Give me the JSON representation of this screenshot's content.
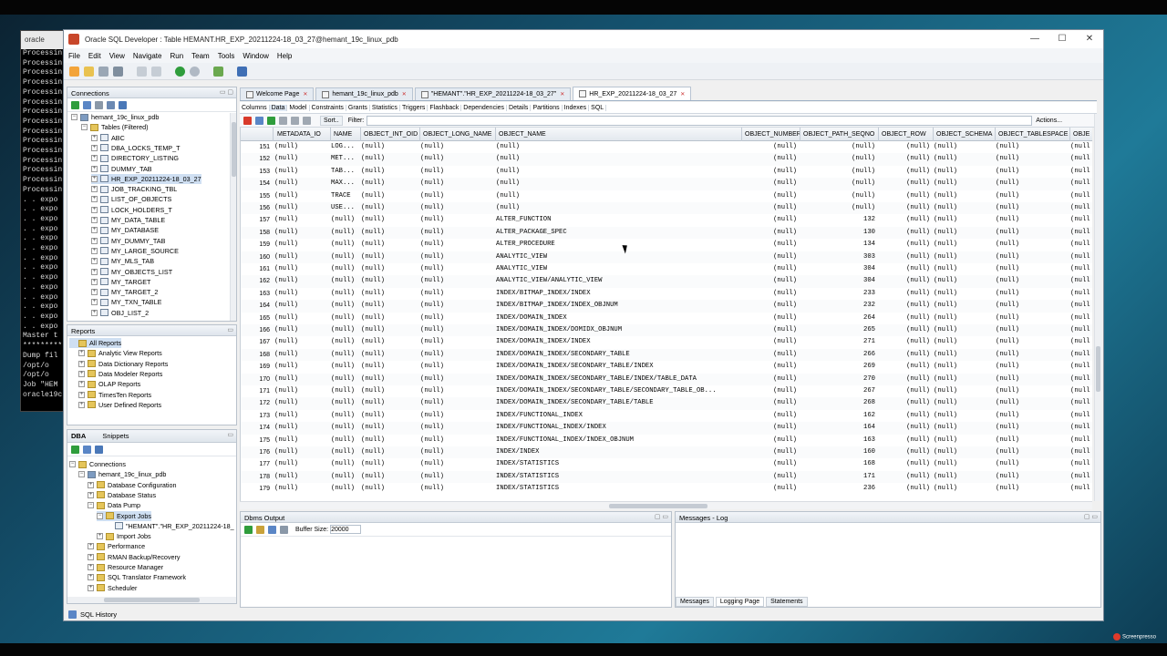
{
  "terminal": {
    "title": "oracle",
    "lines": [
      "Processin",
      "Processin",
      "Processin",
      "Processin",
      "Processin",
      "Processin",
      "Processin",
      "Processin",
      "Processin",
      "Processin",
      "Processin",
      "Processin",
      "Processin",
      "Processin",
      "Processin",
      ". . expo",
      ". . expo",
      ". . expo",
      ". . expo",
      ". . expo",
      ". . expo",
      ". . expo",
      ". . expo",
      ". . expo",
      ". . expo",
      ". . expo",
      ". . expo",
      ". . expo",
      ". . expo",
      "Master t",
      "*********",
      "Dump fil",
      "  /opt/o",
      "  /opt/o",
      "Job \"HEM",
      "oracle19c"
    ]
  },
  "window": {
    "title": "Oracle SQL Developer : Table HEMANT.HR_EXP_20211224-18_03_27@hemant_19c_linux_pdb",
    "minimize": "—",
    "maximize": "☐",
    "close": "✕"
  },
  "menu": [
    "File",
    "Edit",
    "View",
    "Navigate",
    "Run",
    "Team",
    "Tools",
    "Window",
    "Help"
  ],
  "connections": {
    "title": "Connections",
    "nodes": [
      {
        "label": "hemant_19c_linux_pdb",
        "level": 0,
        "icon": "db",
        "exp": "−"
      },
      {
        "label": "Tables (Filtered)",
        "level": 1,
        "icon": "folder",
        "exp": "−"
      },
      {
        "label": "ABC",
        "level": 2,
        "icon": "table",
        "exp": "+"
      },
      {
        "label": "DBA_LOCKS_TEMP_T",
        "level": 2,
        "icon": "table",
        "exp": "+"
      },
      {
        "label": "DIRECTORY_LISTING",
        "level": 2,
        "icon": "table",
        "exp": "+"
      },
      {
        "label": "DUMMY_TAB",
        "level": 2,
        "icon": "table",
        "exp": "+"
      },
      {
        "label": "HR_EXP_20211224-18_03_27",
        "level": 2,
        "icon": "table",
        "exp": "+",
        "selected": true
      },
      {
        "label": "JOB_TRACKING_TBL",
        "level": 2,
        "icon": "table",
        "exp": "+"
      },
      {
        "label": "LIST_OF_OBJECTS",
        "level": 2,
        "icon": "table",
        "exp": "+"
      },
      {
        "label": "LOCK_HOLDERS_T",
        "level": 2,
        "icon": "table",
        "exp": "+"
      },
      {
        "label": "MY_DATA_TABLE",
        "level": 2,
        "icon": "table",
        "exp": "+"
      },
      {
        "label": "MY_DATABASE",
        "level": 2,
        "icon": "table",
        "exp": "+"
      },
      {
        "label": "MY_DUMMY_TAB",
        "level": 2,
        "icon": "table",
        "exp": "+"
      },
      {
        "label": "MY_LARGE_SOURCE",
        "level": 2,
        "icon": "table",
        "exp": "+"
      },
      {
        "label": "MY_MLS_TAB",
        "level": 2,
        "icon": "table",
        "exp": "+"
      },
      {
        "label": "MY_OBJECTS_LIST",
        "level": 2,
        "icon": "table",
        "exp": "+"
      },
      {
        "label": "MY_TARGET",
        "level": 2,
        "icon": "table",
        "exp": "+"
      },
      {
        "label": "MY_TARGET_2",
        "level": 2,
        "icon": "table",
        "exp": "+"
      },
      {
        "label": "MY_TXN_TABLE",
        "level": 2,
        "icon": "table",
        "exp": "+"
      },
      {
        "label": "OBJ_LIST_2",
        "level": 2,
        "icon": "table",
        "exp": "+"
      }
    ]
  },
  "reports": {
    "title": "Reports",
    "nodes": [
      {
        "label": "All Reports",
        "level": 0,
        "icon": "folder",
        "exp": "",
        "selected": true
      },
      {
        "label": "Analytic View Reports",
        "level": 1,
        "icon": "folder",
        "exp": "+"
      },
      {
        "label": "Data Dictionary Reports",
        "level": 1,
        "icon": "folder",
        "exp": "+"
      },
      {
        "label": "Data Modeler Reports",
        "level": 1,
        "icon": "folder",
        "exp": "+"
      },
      {
        "label": "OLAP Reports",
        "level": 1,
        "icon": "folder",
        "exp": "+"
      },
      {
        "label": "TimesTen Reports",
        "level": 1,
        "icon": "folder",
        "exp": "+"
      },
      {
        "label": "User Defined Reports",
        "level": 1,
        "icon": "folder",
        "exp": "+"
      }
    ]
  },
  "dba": {
    "tabs": [
      "DBA",
      "Snippets"
    ],
    "nodes": [
      {
        "label": "Connections",
        "level": 0,
        "icon": "folder",
        "exp": "−"
      },
      {
        "label": "hemant_19c_linux_pdb",
        "level": 1,
        "icon": "db",
        "exp": "−"
      },
      {
        "label": "Database Configuration",
        "level": 2,
        "icon": "folder",
        "exp": "+"
      },
      {
        "label": "Database Status",
        "level": 2,
        "icon": "folder",
        "exp": "+"
      },
      {
        "label": "Data Pump",
        "level": 2,
        "icon": "folder",
        "exp": "−"
      },
      {
        "label": "Export Jobs",
        "level": 3,
        "icon": "folder",
        "exp": "−",
        "selected": true
      },
      {
        "label": "\"HEMANT\".\"HR_EXP_20211224-18_",
        "level": 4,
        "icon": "table",
        "exp": ""
      },
      {
        "label": "Import Jobs",
        "level": 3,
        "icon": "folder",
        "exp": "+"
      },
      {
        "label": "Performance",
        "level": 2,
        "icon": "folder",
        "exp": "+"
      },
      {
        "label": "RMAN Backup/Recovery",
        "level": 2,
        "icon": "folder",
        "exp": "+"
      },
      {
        "label": "Resource Manager",
        "level": 2,
        "icon": "folder",
        "exp": "+"
      },
      {
        "label": "SQL Translator Framework",
        "level": 2,
        "icon": "folder",
        "exp": "+"
      },
      {
        "label": "Scheduler",
        "level": 2,
        "icon": "folder",
        "exp": "+"
      }
    ]
  },
  "doc_tabs": [
    {
      "label": "Welcome Page",
      "active": false
    },
    {
      "label": "hemant_19c_linux_pdb",
      "active": false
    },
    {
      "label": "\"HEMANT\".\"HR_EXP_20211224-18_03_27\"",
      "active": false
    },
    {
      "label": "HR_EXP_20211224-18_03_27",
      "active": true
    }
  ],
  "sub_tabs": [
    "Columns",
    "Data",
    "Model",
    "Constraints",
    "Grants",
    "Statistics",
    "Triggers",
    "Flashback",
    "Dependencies",
    "Details",
    "Partitions",
    "Indexes",
    "SQL"
  ],
  "grid_toolbar": {
    "sort": "Sort..",
    "filter_label": "Filter:",
    "filter_value": "",
    "actions": "Actions..."
  },
  "columns": [
    "",
    "METADATA_IO",
    "NAME",
    "OBJECT_INT_OID",
    "OBJECT_LONG_NAME",
    "OBJECT_NAME",
    "OBJECT_NUMBER",
    "OBJECT_PATH_SEQNO",
    "OBJECT_ROW",
    "OBJECT_SCHEMA",
    "OBJECT_TABLESPACE",
    "OBJE"
  ],
  "rows": [
    [
      "151",
      "(null)",
      "LOG...",
      "(null)",
      "(null)",
      "(null)",
      "(null)",
      "(null)",
      "(null)",
      "(null)",
      "(null)",
      "(null"
    ],
    [
      "152",
      "(null)",
      "MET...",
      "(null)",
      "(null)",
      "(null)",
      "(null)",
      "(null)",
      "(null)",
      "(null)",
      "(null)",
      "(null"
    ],
    [
      "153",
      "(null)",
      "TAB...",
      "(null)",
      "(null)",
      "(null)",
      "(null)",
      "(null)",
      "(null)",
      "(null)",
      "(null)",
      "(null"
    ],
    [
      "154",
      "(null)",
      "MAX...",
      "(null)",
      "(null)",
      "(null)",
      "(null)",
      "(null)",
      "(null)",
      "(null)",
      "(null)",
      "(null"
    ],
    [
      "155",
      "(null)",
      "TRACE",
      "(null)",
      "(null)",
      "(null)",
      "(null)",
      "(null)",
      "(null)",
      "(null)",
      "(null)",
      "(null"
    ],
    [
      "156",
      "(null)",
      "USE...",
      "(null)",
      "(null)",
      "(null)",
      "(null)",
      "(null)",
      "(null)",
      "(null)",
      "(null)",
      "(null"
    ],
    [
      "157",
      "(null)",
      "(null)",
      "(null)",
      "(null)",
      "ALTER_FUNCTION",
      "(null)",
      "132",
      "(null)",
      "(null)",
      "(null)",
      "(null"
    ],
    [
      "158",
      "(null)",
      "(null)",
      "(null)",
      "(null)",
      "ALTER_PACKAGE_SPEC",
      "(null)",
      "130",
      "(null)",
      "(null)",
      "(null)",
      "(null"
    ],
    [
      "159",
      "(null)",
      "(null)",
      "(null)",
      "(null)",
      "ALTER_PROCEDURE",
      "(null)",
      "134",
      "(null)",
      "(null)",
      "(null)",
      "(null"
    ],
    [
      "160",
      "(null)",
      "(null)",
      "(null)",
      "(null)",
      "ANALYTIC_VIEW",
      "(null)",
      "303",
      "(null)",
      "(null)",
      "(null)",
      "(null"
    ],
    [
      "161",
      "(null)",
      "(null)",
      "(null)",
      "(null)",
      "ANALYTIC_VIEW",
      "(null)",
      "304",
      "(null)",
      "(null)",
      "(null)",
      "(null"
    ],
    [
      "162",
      "(null)",
      "(null)",
      "(null)",
      "(null)",
      "ANALYTIC_VIEW/ANALYTIC_VIEW",
      "(null)",
      "304",
      "(null)",
      "(null)",
      "(null)",
      "(null"
    ],
    [
      "163",
      "(null)",
      "(null)",
      "(null)",
      "(null)",
      "INDEX/BITMAP_INDEX/INDEX",
      "(null)",
      "233",
      "(null)",
      "(null)",
      "(null)",
      "(null"
    ],
    [
      "164",
      "(null)",
      "(null)",
      "(null)",
      "(null)",
      "INDEX/BITMAP_INDEX/INDEX_OBJNUM",
      "(null)",
      "232",
      "(null)",
      "(null)",
      "(null)",
      "(null"
    ],
    [
      "165",
      "(null)",
      "(null)",
      "(null)",
      "(null)",
      "INDEX/DOMAIN_INDEX",
      "(null)",
      "264",
      "(null)",
      "(null)",
      "(null)",
      "(null"
    ],
    [
      "166",
      "(null)",
      "(null)",
      "(null)",
      "(null)",
      "INDEX/DOMAIN_INDEX/DOMIDX_OBJNUM",
      "(null)",
      "265",
      "(null)",
      "(null)",
      "(null)",
      "(null"
    ],
    [
      "167",
      "(null)",
      "(null)",
      "(null)",
      "(null)",
      "INDEX/DOMAIN_INDEX/INDEX",
      "(null)",
      "271",
      "(null)",
      "(null)",
      "(null)",
      "(null"
    ],
    [
      "168",
      "(null)",
      "(null)",
      "(null)",
      "(null)",
      "INDEX/DOMAIN_INDEX/SECONDARY_TABLE",
      "(null)",
      "266",
      "(null)",
      "(null)",
      "(null)",
      "(null"
    ],
    [
      "169",
      "(null)",
      "(null)",
      "(null)",
      "(null)",
      "INDEX/DOMAIN_INDEX/SECONDARY_TABLE/INDEX",
      "(null)",
      "269",
      "(null)",
      "(null)",
      "(null)",
      "(null"
    ],
    [
      "170",
      "(null)",
      "(null)",
      "(null)",
      "(null)",
      "INDEX/DOMAIN_INDEX/SECONDARY_TABLE/INDEX/TABLE_DATA",
      "(null)",
      "270",
      "(null)",
      "(null)",
      "(null)",
      "(null"
    ],
    [
      "171",
      "(null)",
      "(null)",
      "(null)",
      "(null)",
      "INDEX/DOMAIN_INDEX/SECONDARY_TABLE/SECONDARY_TABLE_OB...",
      "(null)",
      "267",
      "(null)",
      "(null)",
      "(null)",
      "(null"
    ],
    [
      "172",
      "(null)",
      "(null)",
      "(null)",
      "(null)",
      "INDEX/DOMAIN_INDEX/SECONDARY_TABLE/TABLE",
      "(null)",
      "268",
      "(null)",
      "(null)",
      "(null)",
      "(null"
    ],
    [
      "173",
      "(null)",
      "(null)",
      "(null)",
      "(null)",
      "INDEX/FUNCTIONAL_INDEX",
      "(null)",
      "162",
      "(null)",
      "(null)",
      "(null)",
      "(null"
    ],
    [
      "174",
      "(null)",
      "(null)",
      "(null)",
      "(null)",
      "INDEX/FUNCTIONAL_INDEX/INDEX",
      "(null)",
      "164",
      "(null)",
      "(null)",
      "(null)",
      "(null"
    ],
    [
      "175",
      "(null)",
      "(null)",
      "(null)",
      "(null)",
      "INDEX/FUNCTIONAL_INDEX/INDEX_OBJNUM",
      "(null)",
      "163",
      "(null)",
      "(null)",
      "(null)",
      "(null"
    ],
    [
      "176",
      "(null)",
      "(null)",
      "(null)",
      "(null)",
      "INDEX/INDEX",
      "(null)",
      "160",
      "(null)",
      "(null)",
      "(null)",
      "(null"
    ],
    [
      "177",
      "(null)",
      "(null)",
      "(null)",
      "(null)",
      "INDEX/STATISTICS",
      "(null)",
      "168",
      "(null)",
      "(null)",
      "(null)",
      "(null"
    ],
    [
      "178",
      "(null)",
      "(null)",
      "(null)",
      "(null)",
      "INDEX/STATISTICS",
      "(null)",
      "171",
      "(null)",
      "(null)",
      "(null)",
      "(null"
    ],
    [
      "179",
      "(null)",
      "(null)",
      "(null)",
      "(null)",
      "INDEX/STATISTICS",
      "(null)",
      "236",
      "(null)",
      "(null)",
      "(null)",
      "(null"
    ]
  ],
  "dbms": {
    "title": "Dbms Output",
    "buffer_label": "Buffer Size:",
    "buffer_value": "20000"
  },
  "messages": {
    "title": "Messages - Log",
    "tabs": [
      "Messages",
      "Logging Page",
      "Statements"
    ]
  },
  "sql_history": "SQL History",
  "watermark": {
    "line1": "Screenpresso",
    ".com": ".com"
  }
}
